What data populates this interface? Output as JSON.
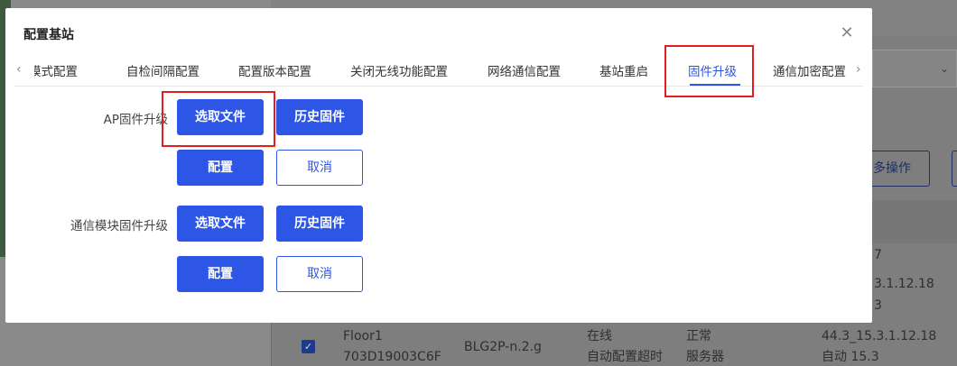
{
  "modal": {
    "title": "配置基站",
    "close_icon": "close-icon",
    "tabs": [
      {
        "label": "模式配置",
        "active": false
      },
      {
        "label": "自检间隔配置",
        "active": false
      },
      {
        "label": "配置版本配置",
        "active": false
      },
      {
        "label": "关闭无线功能配置",
        "active": false
      },
      {
        "label": "网络通信配置",
        "active": false
      },
      {
        "label": "基站重启",
        "active": false
      },
      {
        "label": "固件升级",
        "active": true
      },
      {
        "label": "通信加密配置",
        "active": false
      }
    ],
    "sections": [
      {
        "label": "AP固件升级",
        "select_file": "选取文件",
        "history": "历史固件",
        "configure": "配置",
        "cancel": "取消"
      },
      {
        "label": "通信模块固件升级",
        "select_file": "选取文件",
        "history": "历史固件",
        "configure": "配置",
        "cancel": "取消"
      }
    ]
  },
  "background": {
    "more_button": "多操作",
    "row": {
      "name": "Floor1",
      "mac": "703D19003C6F",
      "model": "BLG2P-n.2.g",
      "status": "在线",
      "status2": "自动配置超时",
      "state": "正常",
      "state2": "服务器",
      "version": "44.3_15.3.1.12.18",
      "version2": "自动 15.3"
    },
    "partial_lines": [
      "7",
      "3.1.12.18",
      "3"
    ]
  },
  "colors": {
    "accent": "#2e56e6",
    "highlight": "#e02020",
    "overlay": "#7f7f7f"
  }
}
